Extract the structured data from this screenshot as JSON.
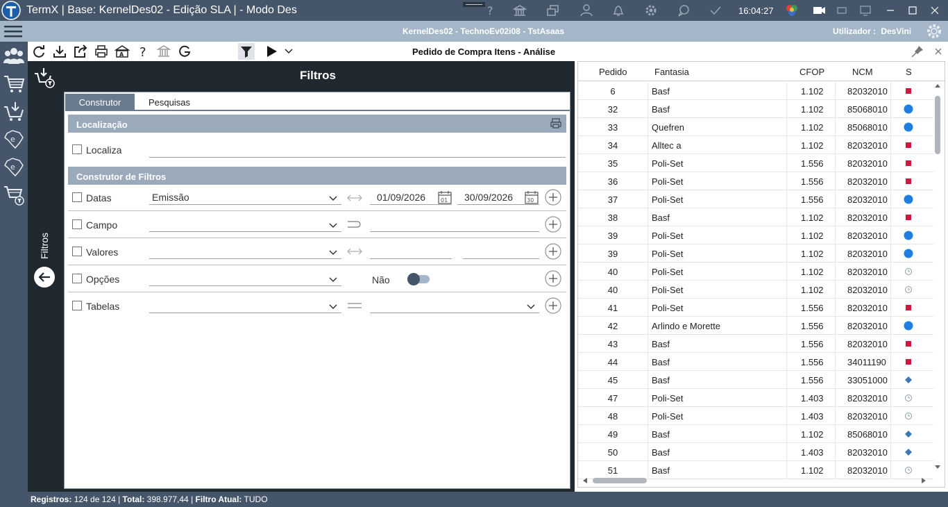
{
  "window": {
    "title": "TermX | Base: KernelDes02 - Edição SLA | - Modo Des",
    "clock": "16:04:27",
    "title_icons": [
      "help-icon",
      "bank-icon",
      "windows-icon",
      "user-icon",
      "bell-icon",
      "gear-icon",
      "chat-icon",
      "check-icon",
      "palette-icon",
      "camera-icon",
      "minimize-alt-icon",
      "monitor-icon",
      "minimize-icon",
      "maximize-icon",
      "close-icon"
    ]
  },
  "infobar": {
    "center": "KernelDes02 - TechnoEv02i08 - TstAsaas",
    "user_label": "Utilizador :",
    "user_name": "DesVini"
  },
  "toolbar": {
    "page_title": "Pedido de Compra Itens - Análise"
  },
  "filters": {
    "header": "Filtros",
    "side_label": "Filtros",
    "tabs": [
      "Construtor",
      "Pesquisas"
    ],
    "section_localizacao": "Localização",
    "localiza_label": "Localiza",
    "section_construtor": "Construtor de Filtros",
    "rows": {
      "datas": {
        "label": "Datas",
        "select": "Emissão",
        "date_from": "01/09/2026",
        "date_to": "30/09/2026",
        "cal_from_day": "01",
        "cal_to_day": "30"
      },
      "campo": {
        "label": "Campo"
      },
      "valores": {
        "label": "Valores"
      },
      "opcoes": {
        "label": "Opções",
        "toggle_label": "Não"
      },
      "tabelas": {
        "label": "Tabelas"
      }
    }
  },
  "grid": {
    "columns": [
      "Pedido",
      "Fantasia",
      "CFOP",
      "NCM",
      "S"
    ],
    "rows": [
      {
        "pedido": "6",
        "fantasia": "Basf",
        "cfop": "1.102",
        "ncm": "82032010",
        "s": "red-square"
      },
      {
        "pedido": "32",
        "fantasia": "Basf",
        "cfop": "1.102",
        "ncm": "85068010",
        "s": "blue-circle"
      },
      {
        "pedido": "33",
        "fantasia": "Quefren",
        "cfop": "1.102",
        "ncm": "85068010",
        "s": "blue-circle"
      },
      {
        "pedido": "34",
        "fantasia": "Alltec a",
        "cfop": "1.102",
        "ncm": "82032010",
        "s": "red-square"
      },
      {
        "pedido": "35",
        "fantasia": "Poli-Set",
        "cfop": "1.556",
        "ncm": "82032010",
        "s": "red-square"
      },
      {
        "pedido": "36",
        "fantasia": "Poli-Set",
        "cfop": "1.556",
        "ncm": "82032010",
        "s": "red-square"
      },
      {
        "pedido": "37",
        "fantasia": "Poli-Set",
        "cfop": "1.556",
        "ncm": "82032010",
        "s": "blue-circle"
      },
      {
        "pedido": "38",
        "fantasia": "Basf",
        "cfop": "1.102",
        "ncm": "82032010",
        "s": "red-square"
      },
      {
        "pedido": "39",
        "fantasia": "Poli-Set",
        "cfop": "1.102",
        "ncm": "82032010",
        "s": "blue-circle"
      },
      {
        "pedido": "39",
        "fantasia": "Poli-Set",
        "cfop": "1.102",
        "ncm": "82032010",
        "s": "blue-circle"
      },
      {
        "pedido": "40",
        "fantasia": "Poli-Set",
        "cfop": "1.102",
        "ncm": "82032010",
        "s": "clock"
      },
      {
        "pedido": "40",
        "fantasia": "Poli-Set",
        "cfop": "1.102",
        "ncm": "82032010",
        "s": "clock"
      },
      {
        "pedido": "41",
        "fantasia": "Poli-Set",
        "cfop": "1.556",
        "ncm": "82032010",
        "s": "red-square"
      },
      {
        "pedido": "42",
        "fantasia": "Arlindo e Morette",
        "cfop": "1.556",
        "ncm": "82032010",
        "s": "blue-circle"
      },
      {
        "pedido": "43",
        "fantasia": "Basf",
        "cfop": "1.556",
        "ncm": "82032010",
        "s": "red-square"
      },
      {
        "pedido": "44",
        "fantasia": "Basf",
        "cfop": "1.556",
        "ncm": "34011190",
        "s": "red-square"
      },
      {
        "pedido": "45",
        "fantasia": "Basf",
        "cfop": "1.556",
        "ncm": "33051000",
        "s": "blue-diamond"
      },
      {
        "pedido": "47",
        "fantasia": "Poli-Set",
        "cfop": "1.403",
        "ncm": "82032010",
        "s": "clock"
      },
      {
        "pedido": "48",
        "fantasia": "Poli-Set",
        "cfop": "1.403",
        "ncm": "82032010",
        "s": "clock"
      },
      {
        "pedido": "49",
        "fantasia": "Basf",
        "cfop": "1.102",
        "ncm": "85068010",
        "s": "blue-diamond"
      },
      {
        "pedido": "50",
        "fantasia": "Basf",
        "cfop": "1.403",
        "ncm": "82032010",
        "s": "blue-diamond"
      },
      {
        "pedido": "51",
        "fantasia": "Basf",
        "cfop": "1.102",
        "ncm": "82032010",
        "s": "clock"
      }
    ]
  },
  "status": {
    "registros_label": "Registros:",
    "registros_value": "124 de 124",
    "total_label": "Total:",
    "total_value": "398.977,44",
    "filtro_label": "Filtro Atual:",
    "filtro_value": "TUDO"
  },
  "colors": {
    "titlebar": "#46566a",
    "infobar": "#a4b6c8",
    "filter_dark": "#202830",
    "status_red": "#d0183c",
    "status_blue": "#1f7ee0",
    "status_diamond": "#3b78b8"
  }
}
